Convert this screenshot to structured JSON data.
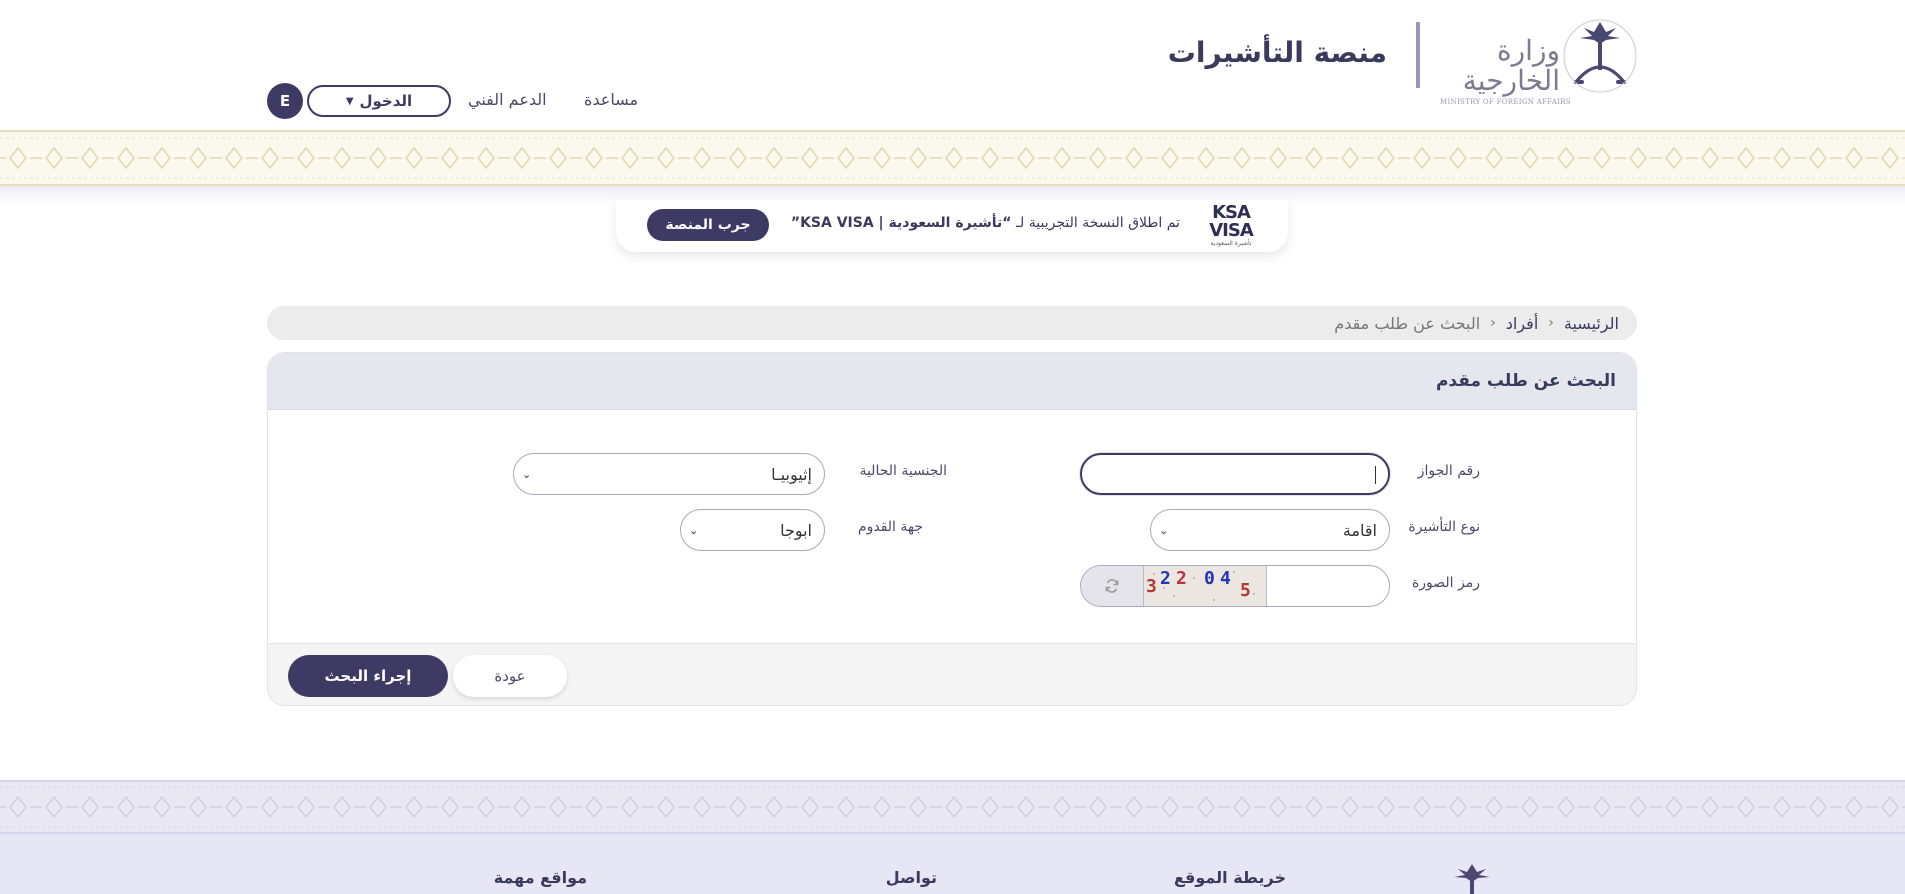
{
  "header": {
    "ministry_name_ar": "وزارة الخارجية",
    "ministry_name_en": "MINISTRY OF FOREIGN AFFAIRS",
    "platform_title": "منصة التأشيرات",
    "nav": {
      "help": "مساعدة",
      "support": "الدعم الفني",
      "login": "الدخول",
      "language": "E"
    }
  },
  "announcement": {
    "logo_line1": "KSA",
    "logo_line2": "VISA",
    "logo_line3": "تأشيرة السعودية",
    "text_prefix": "تم اطلاق النسخة التجريبية لـ",
    "text_bold": "“تأشيرة السعودية | KSA VISA”",
    "button": "جرب المنصة"
  },
  "breadcrumb": {
    "home": "الرئيسية",
    "section": "أفراد",
    "current": "البحث عن طلب مقدم"
  },
  "form": {
    "title": "البحث عن طلب مقدم",
    "passport_label": "رقم الجواز",
    "passport_value": "",
    "nationality_label": "الجنسية الحالية",
    "nationality_value": "إثيوبيـا",
    "visa_type_label": "نوع التأشيرة",
    "visa_type_value": "اقامة",
    "arrival_label": "جهة القدوم",
    "arrival_value": "ابوجا",
    "captcha_label": "رمز الصورة",
    "captcha_text": "322045",
    "captcha_input_value": "",
    "search_button": "إجراء البحث",
    "back_button": "عودة"
  },
  "footer": {
    "sitemap": "خريطة الموقع",
    "contact": "تواصل",
    "important_sites": "مواقع مهمة"
  },
  "colors": {
    "primary": "#3d3b64",
    "breadcrumb_bg": "#ececec",
    "panel_head_bg": "#e6e6ee",
    "footer_bg": "#e7e6f4",
    "band_gold": "#e6dcb8"
  }
}
